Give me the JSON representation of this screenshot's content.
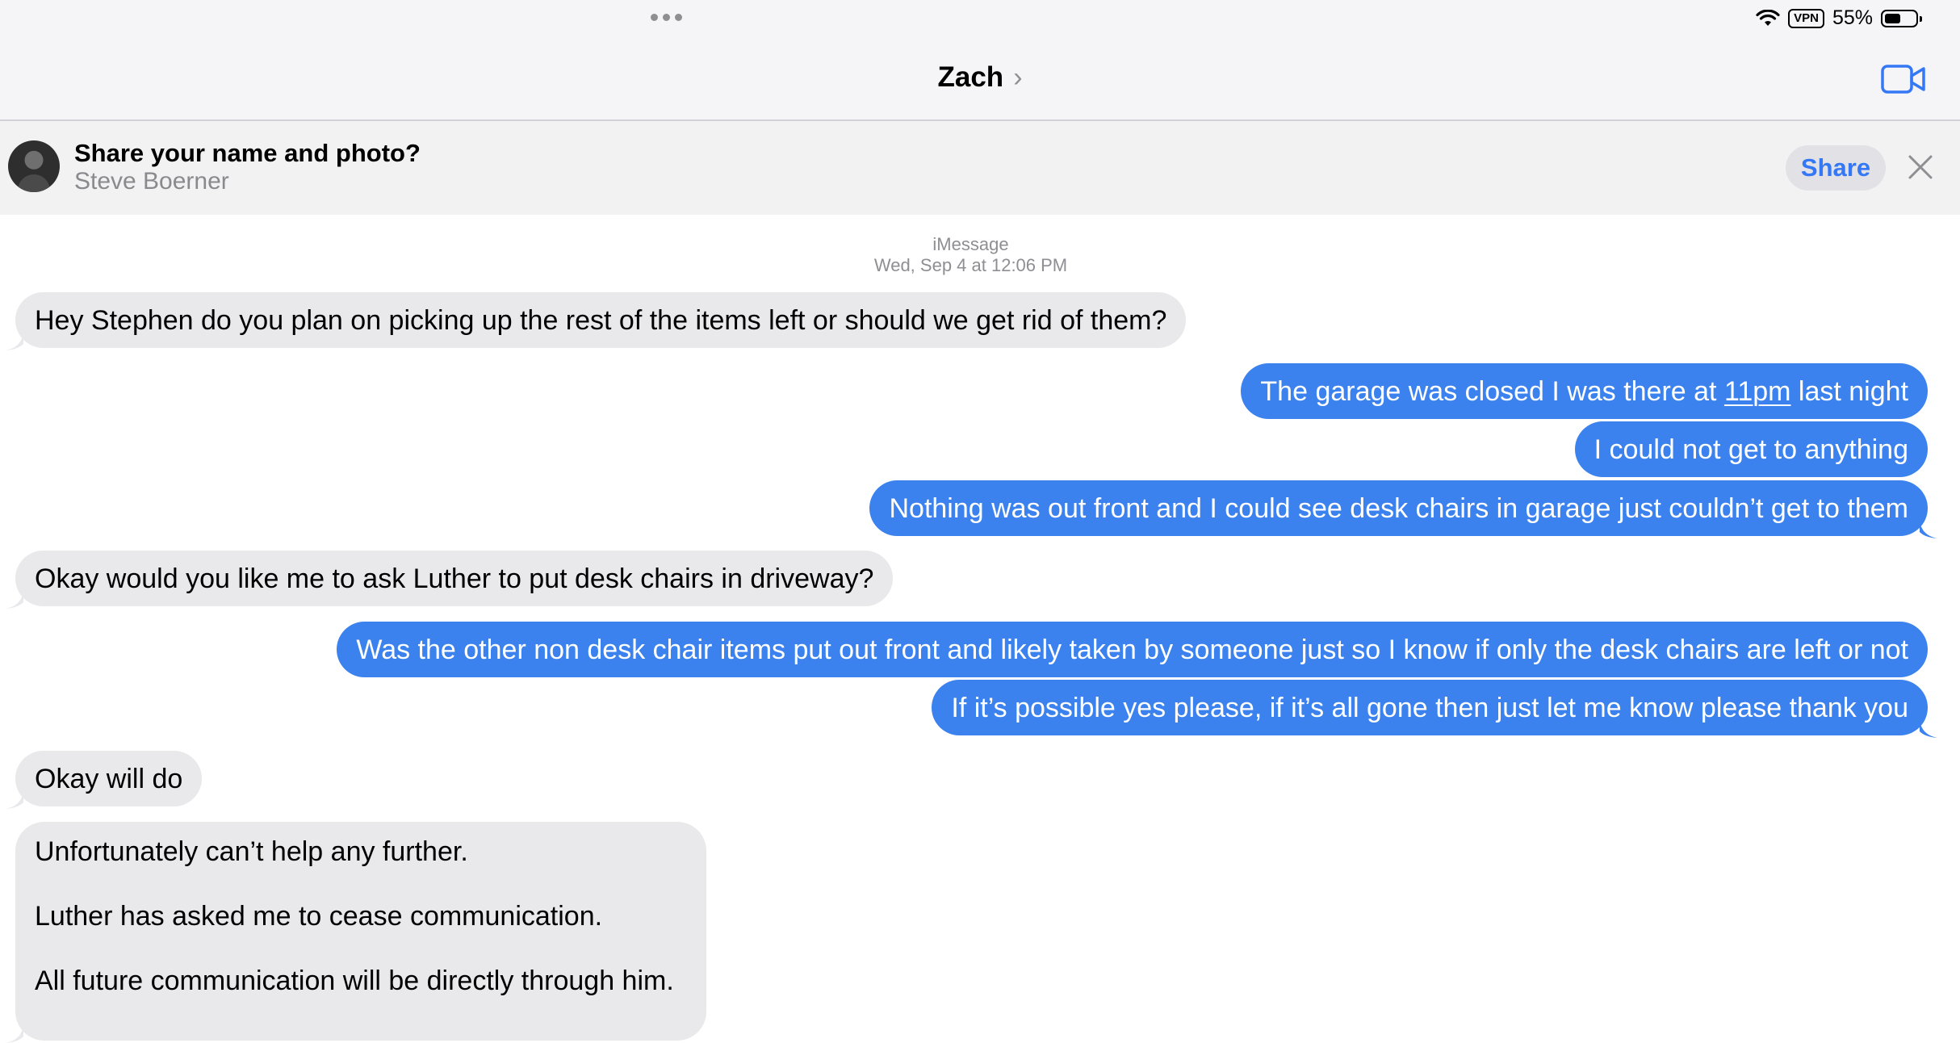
{
  "status_bar": {
    "battery_percent": "55%",
    "vpn_label": "VPN",
    "wifi_icon": "wifi-icon",
    "battery_icon": "battery-icon"
  },
  "header": {
    "contact_name": "Zach",
    "chevron": "›",
    "facetime_icon": "video-camera-icon",
    "multitask_icon": "more-dots-icon"
  },
  "share_banner": {
    "title": "Share your name and photo?",
    "name": "Steve Boerner",
    "share_label": "Share",
    "close_icon": "close-icon"
  },
  "conversation": {
    "service": "iMessage",
    "timestamp": "Wed, Sep 4 at 12:06 PM",
    "messages": [
      {
        "from": "them",
        "text": "Hey Stephen do you plan on picking up the rest of the items left or should we get rid of them?"
      },
      {
        "from": "me",
        "text_before": "The garage was closed I was there at ",
        "link": "11pm",
        "text_after": " last night"
      },
      {
        "from": "me",
        "text": "I could not get to anything"
      },
      {
        "from": "me",
        "text": "Nothing was out front and I could see desk chairs in garage just couldn’t get to them"
      },
      {
        "from": "them",
        "text": "Okay would you like me to ask Luther to put desk chairs in driveway?"
      },
      {
        "from": "me",
        "text": "Was the other non desk chair items put out front and likely taken by someone just so I know if only the desk chairs are left or not"
      },
      {
        "from": "me",
        "text": "If it’s possible yes please, if it’s all gone then just let me know please thank you"
      },
      {
        "from": "them",
        "text": "Okay will do"
      },
      {
        "from": "them",
        "paragraphs": [
          "Unfortunately can’t help any further.",
          "Luther has asked me to cease communication.",
          "All future communication will be directly through him."
        ]
      }
    ]
  },
  "colors": {
    "outgoing_bubble": "#3b82ee",
    "incoming_bubble": "#e9e9eb",
    "accent": "#3478f6"
  }
}
